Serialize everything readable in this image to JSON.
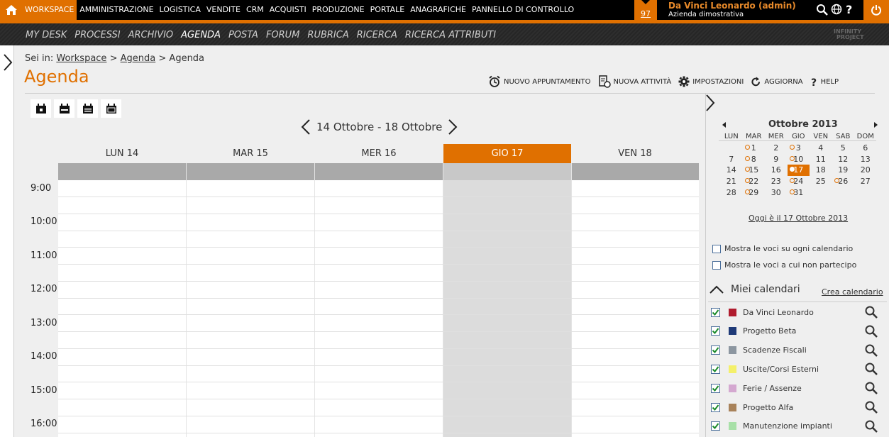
{
  "topbar": {
    "menu": [
      "WORKSPACE",
      "AMMINISTRAZIONE",
      "LOGISTICA",
      "VENDITE",
      "CRM",
      "ACQUISTI",
      "PRODUZIONE",
      "PORTALE",
      "ANAGRAFICHE",
      "PANNELLO DI CONTROLLO"
    ],
    "notifications": "97",
    "user_name": "Da Vinci Leonardo (admin)",
    "company": "Azienda dimostrativa"
  },
  "subnav": [
    "MY DESK",
    "PROCESSI",
    "ARCHIVIO",
    "AGENDA",
    "POSTA",
    "FORUM",
    "RUBRICA",
    "RICERCA",
    "RICERCA ATTRIBUTI"
  ],
  "logo": {
    "line1": "INFINITY",
    "line2": "PROJECT"
  },
  "breadcrumb": {
    "prefix": "Sei in:",
    "items": [
      "Workspace",
      "Agenda",
      "Agenda"
    ],
    "sep": ">"
  },
  "page_title": "Agenda",
  "actions": [
    "NUOVO APPUNTAMENTO",
    "NUOVA ATTIVITÀ",
    "IMPOSTAZIONI",
    "AGGIORNA",
    "HELP"
  ],
  "date_range": "14 Ottobre - 18 Ottobre",
  "days": [
    "LUN 14",
    "MAR 15",
    "MER 16",
    "GIO 17",
    "VEN 18"
  ],
  "today_index": 3,
  "hours": [
    "9:00",
    "10:00",
    "11:00",
    "12:00",
    "13:00",
    "14:00",
    "15:00",
    "16:00"
  ],
  "minical": {
    "title": "Ottobre 2013",
    "weekdays": [
      "LUN",
      "MAR",
      "MER",
      "GIO",
      "VEN",
      "SAB",
      "DOM"
    ],
    "weeks": [
      [
        "",
        "1",
        "2",
        "3",
        "4",
        "5",
        "6"
      ],
      [
        "7",
        "8",
        "9",
        "10",
        "11",
        "12",
        "13"
      ],
      [
        "14",
        "15",
        "16",
        "17",
        "18",
        "19",
        "20"
      ],
      [
        "21",
        "22",
        "23",
        "24",
        "25",
        "26",
        "27"
      ],
      [
        "28",
        "29",
        "30",
        "31",
        "",
        "",
        ""
      ]
    ],
    "event_days": [
      "1",
      "3",
      "8",
      "10",
      "15",
      "17",
      "22",
      "24",
      "26",
      "29",
      "31"
    ],
    "today": "17",
    "today_text": "Oggi è il 17 Ottobre 2013"
  },
  "filters": [
    "Mostra le voci su ogni calendario",
    "Mostra le voci a cui non partecipo"
  ],
  "my_calendars": {
    "title": "Miei calendari",
    "create_link": "Crea calendario",
    "items": [
      {
        "name": "Da Vinci Leonardo",
        "color": "#b01c2e"
      },
      {
        "name": "Progetto Beta",
        "color": "#1f3a78"
      },
      {
        "name": "Scadenze Fiscali",
        "color": "#8c96a0"
      },
      {
        "name": "Uscite/Corsi Esterni",
        "color": "#f4f06a"
      },
      {
        "name": "Ferie / Assenze",
        "color": "#d4a8d0"
      },
      {
        "name": "Progetto Alfa",
        "color": "#a8825a"
      },
      {
        "name": "Manutenzione impianti",
        "color": "#a8e0a8"
      }
    ]
  }
}
